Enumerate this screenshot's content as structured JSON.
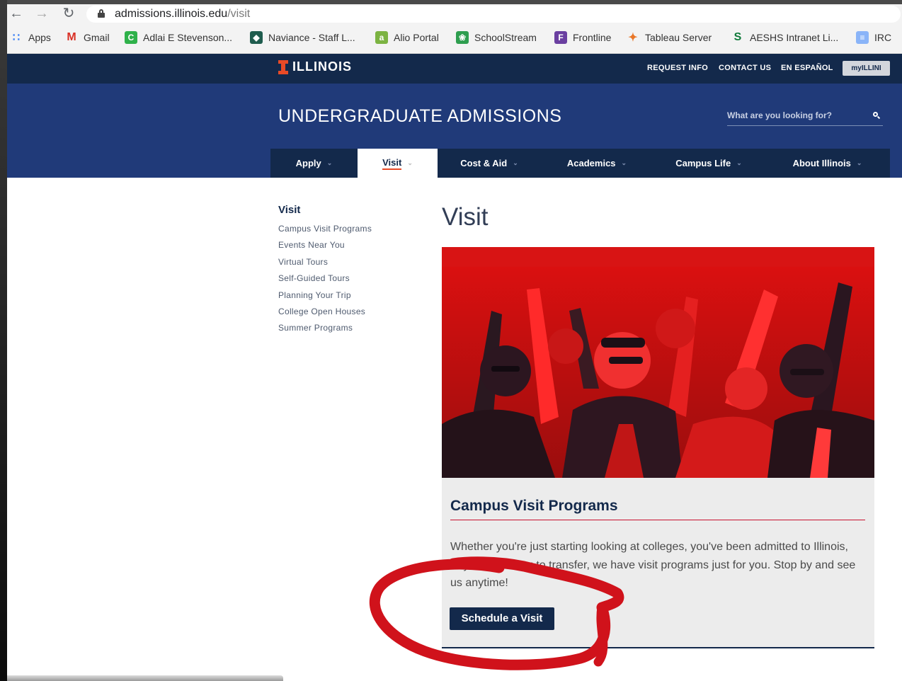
{
  "browser": {
    "url_host": "admissions.illinois.edu",
    "url_path": "/visit",
    "bookmarks": [
      {
        "label": "Apps",
        "icon": "apps-grid-icon",
        "color": "#4285f4"
      },
      {
        "label": "Gmail",
        "icon": "gmail-icon",
        "color": "#d93025"
      },
      {
        "label": "Adlai E Stevenson...",
        "icon": "school-c-icon",
        "color": "#2fb14a"
      },
      {
        "label": "Naviance - Staff L...",
        "icon": "naviance-icon",
        "color": "#1f5c4e"
      },
      {
        "label": "Alio Portal",
        "icon": "alio-icon",
        "color": "#7cb342"
      },
      {
        "label": "SchoolStream",
        "icon": "schoolstream-icon",
        "color": "#2e9e4f"
      },
      {
        "label": "Frontline",
        "icon": "frontline-icon",
        "color": "#6a3fa0"
      },
      {
        "label": "Tableau Server",
        "icon": "tableau-icon",
        "color": "#e97627"
      },
      {
        "label": "AESHS Intranet Li...",
        "icon": "aeshs-icon",
        "color": "#0f7a3a"
      },
      {
        "label": "IRC",
        "icon": "document-icon",
        "color": "#8ab4f8"
      }
    ]
  },
  "header": {
    "logo_text": "ILLINOIS",
    "utility_links": [
      "REQUEST INFO",
      "CONTACT US",
      "EN ESPAÑOL"
    ],
    "myillini_label": "myILLINI",
    "site_title": "UNDERGRADUATE ADMISSIONS",
    "search_placeholder": "What are you looking for?",
    "nav": [
      {
        "label": "Apply",
        "active": false
      },
      {
        "label": "Visit",
        "active": true
      },
      {
        "label": "Cost & Aid",
        "active": false
      },
      {
        "label": "Academics",
        "active": false
      },
      {
        "label": "Campus Life",
        "active": false
      },
      {
        "label": "About Illinois",
        "active": false
      }
    ]
  },
  "sidenav": {
    "title": "Visit",
    "links": [
      "Campus Visit Programs",
      "Events Near You",
      "Virtual Tours",
      "Self-Guided Tours",
      "Planning Your Trip",
      "College Open Houses",
      "Summer Programs"
    ]
  },
  "main": {
    "page_title": "Visit",
    "hero_alt": "crowd-photo",
    "card": {
      "title": "Campus Visit Programs",
      "text": "Whether you're just starting looking at colleges, you've been admitted to Illinois, or you're looking to transfer, we have visit programs just for you. Stop by and see us anytime!",
      "button_label": "Schedule a Visit"
    }
  },
  "colors": {
    "navy": "#13294b",
    "band_blue": "#203a79",
    "orange": "#e84a27",
    "annotation_red": "#d0121b",
    "hero_red": "#b81414"
  }
}
